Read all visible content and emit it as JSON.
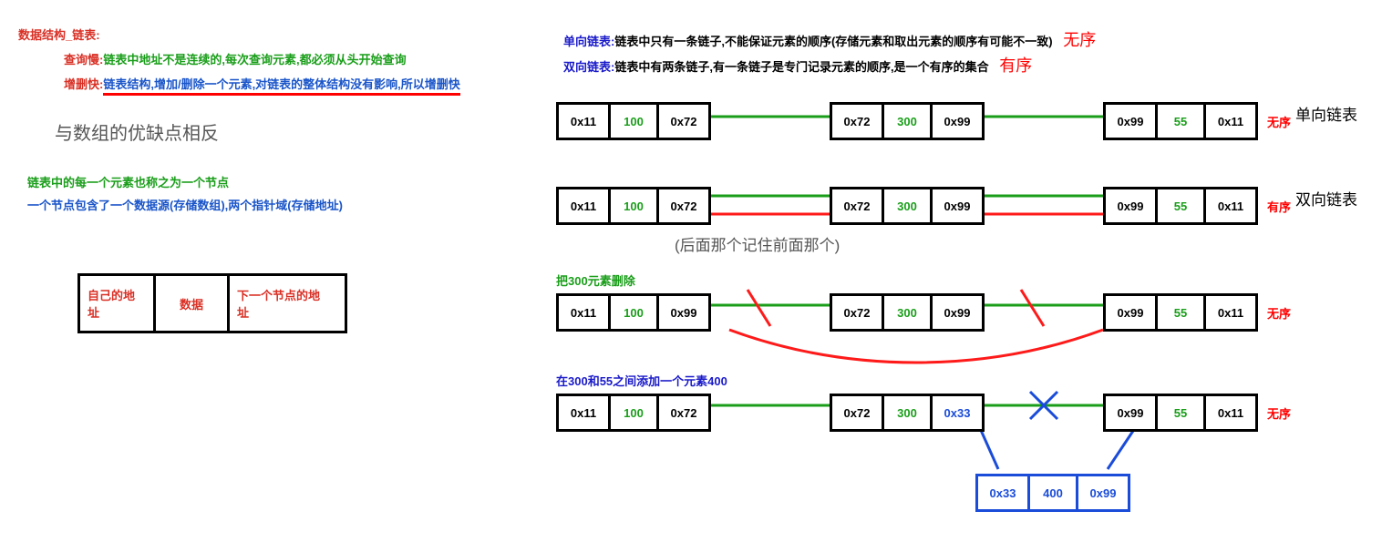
{
  "title": "数据结构_链表:",
  "left": {
    "query_label": "查询慢:",
    "query_text": "链表中地址不是连续的,每次查询元素,都必须从头开始查询",
    "ins_label": "增删快:",
    "ins_text": "链表结构,增加/删除一个元素,对链表的整体结构没有影响,所以增删快",
    "contrast": "与数组的优缺点相反",
    "node_name": "链表中的每一个元素也称之为一个节点",
    "node_composition": "一个节点包含了一个数据源(存储数组),两个指针域(存储地址)",
    "legend": {
      "self_addr": "自己的地址",
      "data": "数据",
      "next_addr": "下一个节点的地址"
    }
  },
  "right": {
    "singly_label": "单向链表:",
    "singly_text": "链表中只有一条链子,不能保证元素的顺序(存储元素和取出元素的顺序有可能不一致)",
    "singly_tag": "无序",
    "doubly_label": "双向链表:",
    "doubly_text": "链表中有两条链子,有一条链子是专门记录元素的顺序,是一个有序的集合",
    "doubly_tag": "有序",
    "row1_label_a": "无序",
    "row1_label_b": "单向链表",
    "row2_label_a": "有序",
    "row2_label_b": "双向链表",
    "row2_note": "(后面那个记住前面那个)",
    "row3_title": "把300元素删除",
    "row3_label": "无序",
    "row4_title": "在300和55之间添加一个元素400",
    "row4_label": "无序"
  },
  "nodes": {
    "r1": [
      {
        "a": "0x11",
        "v": "100",
        "n": "0x72"
      },
      {
        "a": "0x72",
        "v": "300",
        "n": "0x99"
      },
      {
        "a": "0x99",
        "v": "55",
        "n": "0x11"
      }
    ],
    "r2": [
      {
        "a": "0x11",
        "v": "100",
        "n": "0x72"
      },
      {
        "a": "0x72",
        "v": "300",
        "n": "0x99"
      },
      {
        "a": "0x99",
        "v": "55",
        "n": "0x11"
      }
    ],
    "r3": [
      {
        "a": "0x11",
        "v": "100",
        "n": "0x99"
      },
      {
        "a": "0x72",
        "v": "300",
        "n": "0x99"
      },
      {
        "a": "0x99",
        "v": "55",
        "n": "0x11"
      }
    ],
    "r4": [
      {
        "a": "0x11",
        "v": "100",
        "n": "0x72"
      },
      {
        "a": "0x72",
        "v": "300",
        "n": "0x33"
      },
      {
        "a": "0x99",
        "v": "55",
        "n": "0x11"
      }
    ],
    "r4_new": {
      "a": "0x33",
      "v": "400",
      "n": "0x99"
    }
  },
  "colors": {
    "green": "#1a9e1a",
    "red": "#ff1a1a",
    "blue": "#1a4cd9"
  }
}
